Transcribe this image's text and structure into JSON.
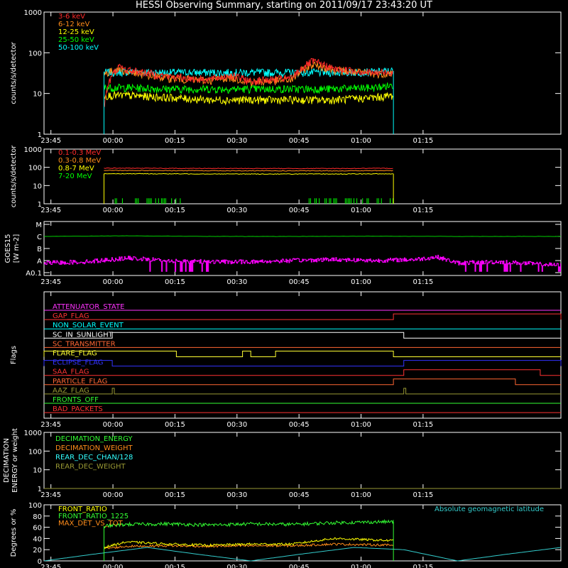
{
  "title": "HESSI Observing Summary, starting on 2011/09/17 23:43:20 UT",
  "time_axis": {
    "range_min": [
      0,
      125
    ],
    "tick_labels": [
      "23:45",
      "00:00",
      "00:15",
      "00:30",
      "00:45",
      "01:00",
      "01:15"
    ],
    "tick_minutes": [
      1.667,
      16.667,
      31.667,
      46.667,
      61.667,
      76.667,
      91.667
    ]
  },
  "chart_data": [
    {
      "type": "line",
      "panel": "low-energy-rates",
      "ylabel": "counts/s/detector",
      "yscale": "log",
      "ylim": [
        1,
        1000
      ],
      "ytick_labels": [
        "1",
        "10",
        "100",
        "1000"
      ],
      "ytick_values": [
        1,
        10,
        100,
        1000
      ],
      "legend_position": "top-left",
      "data_window_min": [
        14.5,
        84.5
      ],
      "series": [
        {
          "name": "3-6 keV",
          "color": "#ff2a2a",
          "x": [
            14.5,
            18,
            20,
            25,
            30,
            35,
            40,
            45,
            50,
            55,
            60,
            65,
            70,
            75,
            80,
            84.5
          ],
          "y": [
            4,
            45,
            38,
            32,
            26,
            24,
            22,
            28,
            20,
            22,
            24,
            62,
            40,
            36,
            32,
            34
          ]
        },
        {
          "name": "6-12 keV",
          "color": "#ff8c1a",
          "x": [
            14.5,
            18,
            20,
            25,
            30,
            35,
            40,
            45,
            50,
            55,
            60,
            65,
            70,
            75,
            80,
            84.5
          ],
          "y": [
            30,
            40,
            34,
            28,
            24,
            22,
            21,
            25,
            19,
            20,
            22,
            52,
            38,
            34,
            30,
            32
          ]
        },
        {
          "name": "12-25 keV",
          "color": "#ffff00",
          "x": [
            14.5,
            20,
            30,
            40,
            50,
            60,
            70,
            80,
            84.5
          ],
          "y": [
            9,
            9,
            8,
            7,
            7,
            7,
            7,
            8,
            9
          ]
        },
        {
          "name": "25-50 keV",
          "color": "#00ff00",
          "x": [
            14.5,
            20,
            30,
            40,
            50,
            60,
            70,
            80,
            84.5
          ],
          "y": [
            14,
            14,
            13,
            13,
            13,
            13,
            13,
            14,
            16
          ]
        },
        {
          "name": "50-100 keV",
          "color": "#00ffff",
          "x": [
            14.5,
            20,
            30,
            40,
            50,
            60,
            70,
            80,
            84.5
          ],
          "y": [
            33,
            34,
            33,
            33,
            33,
            33,
            33,
            34,
            36
          ]
        }
      ]
    },
    {
      "type": "line",
      "panel": "high-energy-rates",
      "ylabel": "counts/s/detector",
      "yscale": "log",
      "ylim": [
        1,
        1000
      ],
      "ytick_labels": [
        "1",
        "10",
        "100",
        "1000"
      ],
      "ytick_values": [
        1,
        10,
        100,
        1000
      ],
      "legend_position": "top-left",
      "data_window_min": [
        14.5,
        84.5
      ],
      "series": [
        {
          "name": "0.1-0.3 MeV",
          "color": "#ff2a2a",
          "x": [
            14.5,
            30,
            50,
            70,
            84.5
          ],
          "y": [
            90,
            88,
            86,
            86,
            88
          ]
        },
        {
          "name": "0.3-0.8 MeV",
          "color": "#ff8c1a",
          "x": [
            14.5,
            30,
            50,
            70,
            84.5
          ],
          "y": [
            68,
            66,
            64,
            64,
            66
          ]
        },
        {
          "name": "0.8-7 MeV",
          "color": "#ffff00",
          "x": [
            14.5,
            30,
            50,
            70,
            84.5
          ],
          "y": [
            45,
            44,
            43,
            43,
            44
          ]
        },
        {
          "name": "7-20 MeV",
          "color": "#00ff00",
          "x": [
            14.5,
            84.5
          ],
          "y": [
            1,
            1
          ]
        }
      ]
    },
    {
      "type": "line",
      "panel": "goes",
      "ylabel": "GOES15 [W m-2]",
      "ytick_labels": [
        "A0.1",
        "A",
        "B",
        "C",
        "M"
      ],
      "ytick_values": [
        0,
        1,
        2,
        3,
        4
      ],
      "series": [
        {
          "name": "GOES long",
          "color": "#00cc00",
          "x": [
            0,
            20,
            40,
            60,
            80,
            100,
            125
          ],
          "y": [
            3.0,
            3.05,
            3.0,
            3.0,
            3.02,
            3.0,
            3.0
          ]
        },
        {
          "name": "GOES short",
          "color": "#ff00ff",
          "x": [
            0,
            10,
            20,
            30,
            40,
            50,
            60,
            70,
            80,
            90,
            95,
            100,
            110,
            120,
            125
          ],
          "y": [
            0.8,
            0.9,
            1.2,
            1.0,
            0.9,
            0.9,
            1.0,
            1.1,
            1.0,
            1.1,
            1.3,
            0.8,
            0.9,
            0.7,
            0.6
          ]
        }
      ]
    },
    {
      "type": "line",
      "panel": "flags",
      "ylabel": "Flags",
      "flags": [
        {
          "name": "ATTENUATOR_STATE",
          "color": "#ff33ff",
          "on": []
        },
        {
          "name": "GAP_FLAG",
          "color": "#ff3333",
          "on": [
            [
              84.5,
              125
            ]
          ]
        },
        {
          "name": "NON_SOLAR_EVENT",
          "color": "#00ffff",
          "on": []
        },
        {
          "name": "SC_IN_SUNLIGHT",
          "color": "#ffffff",
          "on": [
            [
              16.5,
              87
            ]
          ]
        },
        {
          "name": "SC_TRANSMITTER",
          "color": "#ff6633",
          "on": []
        },
        {
          "name": "FLARE_FLAG",
          "color": "#ffff33",
          "on": [
            [
              0,
              32
            ],
            [
              48,
              50
            ],
            [
              56,
              84.5
            ]
          ]
        },
        {
          "name": "ECLIPSE_FLAG",
          "color": "#3333ff",
          "on": [
            [
              0,
              16.5
            ],
            [
              87,
              125
            ]
          ]
        },
        {
          "name": "SAA_FLAG",
          "color": "#ff3333",
          "on": [
            [
              87,
              120
            ]
          ]
        },
        {
          "name": "PARTICLE_FLAG",
          "color": "#ff6633",
          "on": [
            [
              84.5,
              114
            ]
          ]
        },
        {
          "name": "AAZ_FLAG",
          "color": "#999933",
          "on": [
            [
              16.5,
              17
            ],
            [
              87,
              87.5
            ]
          ]
        },
        {
          "name": "FRONTS_OFF",
          "color": "#33ff33",
          "on": []
        },
        {
          "name": "BAD_PACKETS",
          "color": "#ff3333",
          "on": []
        }
      ]
    },
    {
      "type": "line",
      "panel": "decimation",
      "ylabel": "DECIMATION ENERGY or weight",
      "yscale": "log",
      "ylim": [
        1,
        1000
      ],
      "ytick_labels": [
        "1",
        "10",
        "100",
        "1000"
      ],
      "ytick_values": [
        1,
        10,
        100,
        1000
      ],
      "legend_position": "top-left",
      "series": [
        {
          "name": "DECIMATION_ENERGY",
          "color": "#33ff33",
          "x": [],
          "y": []
        },
        {
          "name": "DECIMATION_WEIGHT",
          "color": "#ff8c1a",
          "x": [],
          "y": []
        },
        {
          "name": "REAR_DEC_CHAN/128",
          "color": "#33ffff",
          "x": [],
          "y": []
        },
        {
          "name": "REAR_DEC_WEIGHT",
          "color": "#999933",
          "x": [
            0,
            125
          ],
          "y": [
            1,
            1
          ]
        }
      ]
    },
    {
      "type": "line",
      "panel": "ratios",
      "ylabel": "Degrees or %",
      "ylim": [
        0,
        100
      ],
      "ytick_labels": [
        "0",
        "20",
        "40",
        "60",
        "80",
        "100"
      ],
      "ytick_values": [
        0,
        20,
        40,
        60,
        80,
        100
      ],
      "legend_position": "top-left",
      "annotation": "Absolute geomagnetic latitude",
      "series": [
        {
          "name": "FRONT_RATIO",
          "color": "#ffff00",
          "x": [
            14.5,
            20,
            30,
            40,
            50,
            60,
            70,
            84.5
          ],
          "y": [
            24,
            34,
            30,
            28,
            30,
            30,
            40,
            36
          ]
        },
        {
          "name": "FRONT_RATIO_1225",
          "color": "#33ff33",
          "x": [
            14.5,
            20,
            30,
            40,
            50,
            60,
            70,
            84.5
          ],
          "y": [
            62,
            65,
            66,
            64,
            66,
            65,
            68,
            70
          ]
        },
        {
          "name": "MAX_DET_VS_TOT",
          "color": "#ff8c1a",
          "x": [
            14.5,
            20,
            30,
            40,
            50,
            60,
            70,
            84.5
          ],
          "y": [
            22,
            26,
            27,
            26,
            27,
            27,
            30,
            28
          ]
        },
        {
          "name": "geomagnetic latitude",
          "color": "#33cccc",
          "x": [
            0,
            12,
            25,
            37,
            50,
            62,
            75,
            87,
            100,
            112,
            125
          ],
          "y": [
            0,
            12,
            24,
            12,
            0,
            12,
            24,
            20,
            0,
            12,
            24
          ]
        }
      ]
    }
  ]
}
